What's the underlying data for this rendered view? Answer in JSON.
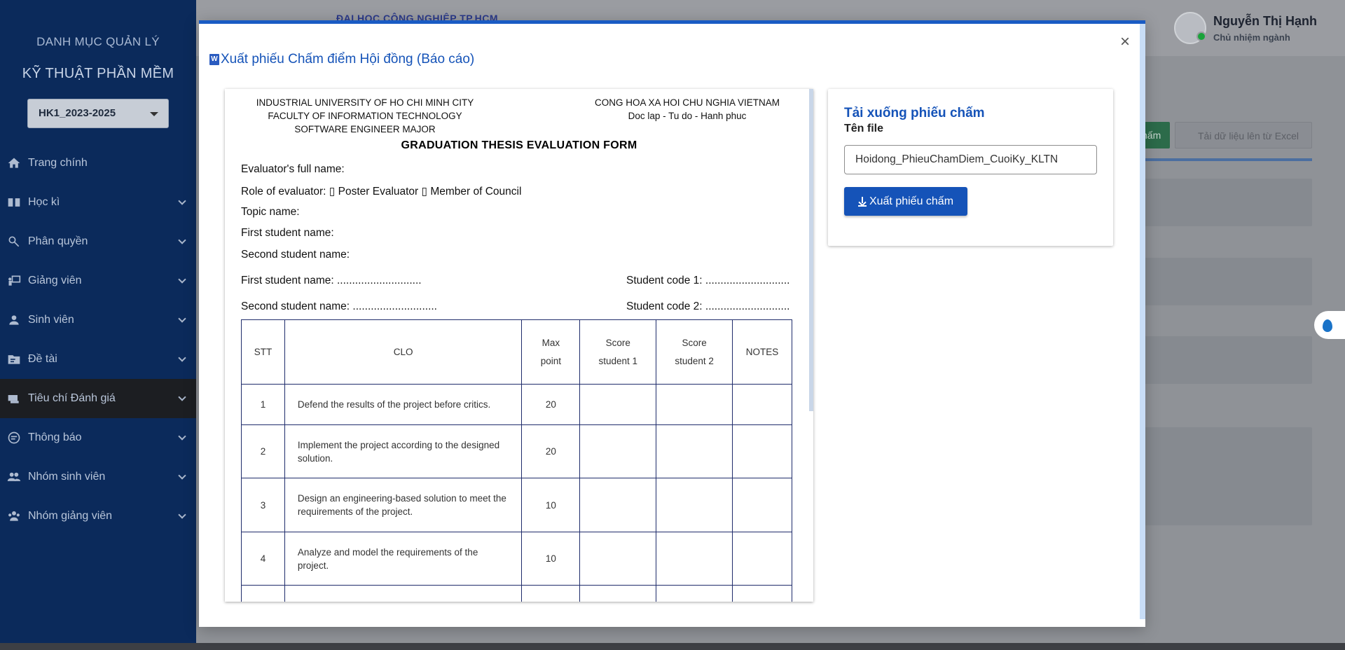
{
  "sidebar": {
    "title1": "DANH MỤC QUẢN LÝ",
    "title2": "KỸ THUẬT PHẦN MỀM",
    "semester": "HK1_2023-2025",
    "items": [
      {
        "label": "Trang chính",
        "icon": "home-icon"
      },
      {
        "label": "Học kì",
        "icon": "book-icon"
      },
      {
        "label": "Phân quyền",
        "icon": "key-icon"
      },
      {
        "label": "Giảng viên",
        "icon": "teacher-icon"
      },
      {
        "label": "Sinh viên",
        "icon": "student-icon"
      },
      {
        "label": "Đề tài",
        "icon": "folder-icon"
      },
      {
        "label": "Tiêu chí Đánh giá",
        "icon": "criteria-icon"
      },
      {
        "label": "Thông báo",
        "icon": "notification-icon"
      },
      {
        "label": "Nhóm sinh viên",
        "icon": "student-group-icon"
      },
      {
        "label": "Nhóm giảng viên",
        "icon": "teacher-group-icon"
      }
    ]
  },
  "header": {
    "brand": "ĐẠI HỌC CÔNG NGHIỆP TP.HCM",
    "user_name": "Nguyễn Thị Hạnh",
    "user_role": "Chủ nhiệm ngành"
  },
  "background": {
    "green_button": "hấm",
    "excel_button": "Tải dữ liệu lên từ Excel"
  },
  "modal": {
    "title": "Xuất phiếu Chấm điểm Hội đồng (Báo cáo)",
    "close": "×"
  },
  "doc": {
    "header_left": [
      "INDUSTRIAL UNIVERSITY OF HO CHI MINH CITY",
      "FACULTY OF INFORMATION TECHNOLOGY",
      "SOFTWARE ENGINEER MAJOR"
    ],
    "header_right": [
      "CONG HOA XA HOI CHU NGHIA VIETNAM",
      "Doc lap - Tu do - Hanh phuc"
    ],
    "title": "GRADUATION THESIS EVALUATION FORM",
    "evaluator": "Evaluator's full name:",
    "role": "Role of evaluator: ▯ Poster Evaluator ▯ Member of Council",
    "topic": "Topic name:",
    "first_student": "First student name:",
    "second_student": "Second student name:",
    "first_student_dots": "First student name: ............................",
    "student_code1": "Student code 1: ............................",
    "second_student_dots": "Second student name: ............................",
    "student_code2": "Student code 2: ............................",
    "table": {
      "headers": [
        "STT",
        "CLO",
        "Max\npoint",
        "Score\nstudent 1",
        "Score\nstudent 2",
        "NOTES"
      ],
      "rows": [
        {
          "stt": "1",
          "clo": "Defend the results of the project before critics.",
          "max": "20"
        },
        {
          "stt": "2",
          "clo": "Implement the project according to the designed solution.",
          "max": "20"
        },
        {
          "stt": "3",
          "clo": "Design an engineering-based solution to meet the requirements of the project.",
          "max": "10"
        },
        {
          "stt": "4",
          "clo": "Analyze and model the requirements of the project.",
          "max": "10"
        }
      ]
    }
  },
  "download": {
    "title": "Tải xuống phiếu chấm",
    "label": "Tên file",
    "filename": "Hoidong_PhieuChamDiem_CuoiKy_KLTN",
    "button": "Xuất phiếu chấm"
  }
}
